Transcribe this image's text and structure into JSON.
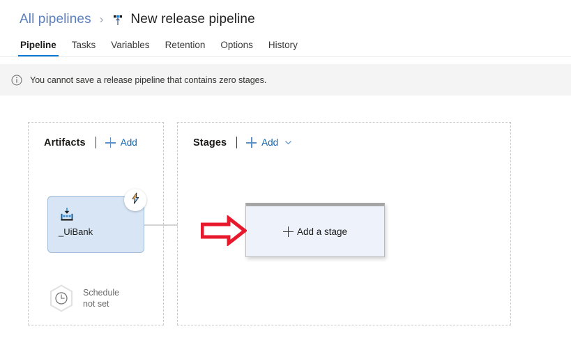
{
  "header": {
    "breadcrumb_link": "All pipelines",
    "breadcrumb_separator": "›",
    "title": "New release pipeline",
    "title_icon": "release-pipeline-icon"
  },
  "tabs": [
    {
      "label": "Pipeline",
      "active": true
    },
    {
      "label": "Tasks",
      "active": false
    },
    {
      "label": "Variables",
      "active": false
    },
    {
      "label": "Retention",
      "active": false
    },
    {
      "label": "Options",
      "active": false
    },
    {
      "label": "History",
      "active": false
    }
  ],
  "banner": {
    "icon": "info-circle-icon",
    "message": "You cannot save a release pipeline that contains zero stages."
  },
  "artifacts": {
    "title": "Artifacts",
    "add_label": "Add",
    "add_icon": "plus-icon",
    "card": {
      "name": "_UiBank",
      "icon": "build-artifact-icon",
      "trigger_badge_icon": "lightning-bolt-icon"
    },
    "schedule": {
      "icon": "clock-icon",
      "line1": "Schedule",
      "line2": "not set"
    }
  },
  "stages": {
    "title": "Stages",
    "add_label": "Add",
    "add_icon": "plus-icon",
    "add_chevron_icon": "chevron-down-icon",
    "add_stage_box_label": "Add a stage",
    "add_stage_box_icon": "plus-icon"
  },
  "annotation": {
    "arrow_icon": "red-arrow-right-icon",
    "arrow_color": "#e8192c"
  },
  "colors": {
    "accent": "#0078d4",
    "link": "#0f62b0",
    "breadcrumb_link": "#5b7fbd",
    "banner_bg": "#f4f4f4",
    "artifact_card_bg": "#d7e5f5",
    "stage_box_bg": "#eef3fb",
    "panel_border": "#c8c8c8"
  }
}
